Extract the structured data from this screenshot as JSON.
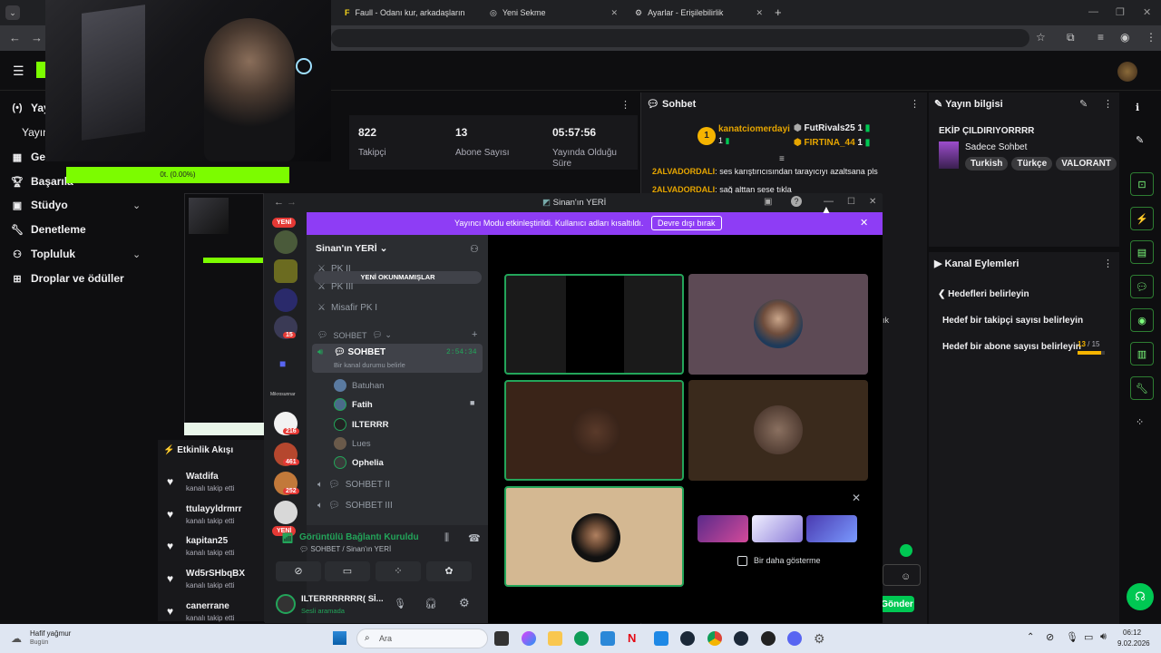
{
  "browser": {
    "tabs": [
      {
        "label": "Faull - Odanı kur, arkadaşlarını"
      },
      {
        "label": "Yeni Sekme"
      },
      {
        "label": "Ayarlar - Erişilebilirlik"
      }
    ]
  },
  "twitch": {
    "nav": [
      {
        "label": "Yay",
        "icon": "broadcast-icon"
      },
      {
        "label": "Yayın"
      },
      {
        "label": "Gel",
        "icon": "chart-icon"
      },
      {
        "label": "Başarıla",
        "icon": "trophy-icon"
      },
      {
        "label": "Stüdyo",
        "icon": "studio-icon"
      },
      {
        "label": "Denetleme",
        "icon": "wrench-icon"
      },
      {
        "label": "Topluluk",
        "icon": "community-icon"
      },
      {
        "label": "Droplar ve ödüller",
        "icon": "gift-icon"
      }
    ],
    "progress_label": "0t. (0.00%)",
    "stats": [
      {
        "value": "822",
        "label": "Takipçi"
      },
      {
        "value": "13",
        "label": "Abone Sayısı"
      },
      {
        "value": "05:57:56",
        "label": "Yayında Olduğu Süre"
      }
    ],
    "chat": {
      "header": "Sohbet",
      "top_user": "kanatciomerdayi",
      "top_user_count": "1",
      "gifters": [
        "FutRivals25",
        "FIRTINA_44"
      ],
      "gifter_counts": [
        "1",
        "1"
      ],
      "messages": [
        {
          "user": "2ALVADORDALI",
          "text": "ses karıştırıcısından tarayıcıyı azaltsana pls"
        },
        {
          "user": "2ALVADORDALI",
          "text": "sağ alttan sese tıkla"
        }
      ],
      "partial_text": "ık",
      "send_label": "Gönder"
    },
    "info": {
      "header": "Yayın bilgisi",
      "title": "EKİP ÇILDIRIYORRRR",
      "category": "Sadece Sohbet",
      "tags": [
        "Turkish",
        "Türkçe",
        "VALORANT"
      ]
    },
    "actions": {
      "header": "Kanal Eylemleri",
      "back_label": "Hedefleri belirleyin",
      "goal1": "Hedef bir takipçi sayısı belirleyin",
      "goal2": "Hedef bir abone sayısı belirleyin",
      "goal2_current": "13",
      "goal2_total": "/ 15",
      "goal2_progress": 0.87
    },
    "feed": {
      "header": "Etkinlik Akışı",
      "items": [
        {
          "name": "Watdifa",
          "sub": "kanalı takip etti"
        },
        {
          "name": "ttulayyldrmrr",
          "sub": "kanalı takip etti"
        },
        {
          "name": "kapitan25",
          "sub": "kanalı takip etti"
        },
        {
          "name": "Wd5rSHbqBX",
          "sub": "kanalı takip etti"
        },
        {
          "name": "canerrane",
          "sub": "kanalı takip etti"
        }
      ]
    }
  },
  "discord": {
    "window_title": "Sinan'ın YERİ",
    "banner_text": "Yayıncı Modu etkinleştirildi. Kullanıcı adları kısaltıldı.",
    "banner_button": "Devre dışı bırak",
    "server_name": "Sinan'ın YERİ",
    "unread_pill": "YENİ OKUNMAMIŞLAR",
    "new_badge": "YENİ",
    "server_badges": [
      "15",
      "216",
      "461",
      "252"
    ],
    "server_label": "Mikrosunnar",
    "channels_top": [
      "PK II",
      "PK III",
      "Misafir PK I"
    ],
    "category": "SOHBET",
    "active_channel": "SOHBET",
    "active_channel_time": "2:54:34",
    "status_hint": "Bir kanal durumu belirle",
    "members": [
      "Batuhan",
      "Fatih",
      "ILTERRR",
      "Lues",
      "Ophelia"
    ],
    "channels_bottom": [
      "SOHBET II",
      "SOHBET III"
    ],
    "voice_status": "Görüntülü Bağlantı Kuruldu",
    "voice_channel": "SOHBET / Sinan'ın YERİ",
    "user_name": "ILTERRRRRRR( Sİ...",
    "user_status": "Sesli aramada",
    "promo_checkbox": "Bir daha gösterme"
  },
  "taskbar": {
    "weather_title": "Hafif yağmur",
    "weather_sub": "Bugün",
    "search": "Ara",
    "time": "06:12",
    "date": "9.02.2026"
  },
  "colors": {
    "accent_green": "#7cfc00",
    "discord_purple": "#8e3df5",
    "twitch_bg": "#0e0e10",
    "chat_user": "#e6a500"
  }
}
